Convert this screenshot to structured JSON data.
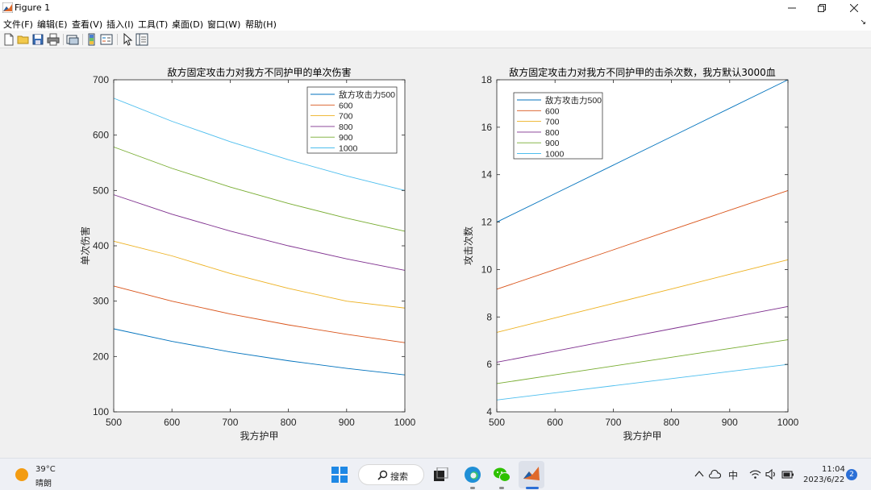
{
  "window": {
    "title": "Figure 1"
  },
  "menu": {
    "items": [
      "文件(F)",
      "编辑(E)",
      "查看(V)",
      "插入(I)",
      "工具(T)",
      "桌面(D)",
      "窗口(W)",
      "帮助(H)"
    ],
    "overflow_arrow": "↘"
  },
  "toolbar": {
    "icons": [
      "new-figure-icon",
      "open-icon",
      "save-icon",
      "print-icon",
      "link-plot-icon",
      "colorbar-icon",
      "legend-icon",
      "pointer-icon",
      "property-inspector-icon"
    ]
  },
  "colors": {
    "series": [
      "#0072BD",
      "#D95319",
      "#EDB120",
      "#7E2F8E",
      "#77AC30",
      "#4DBEEE"
    ]
  },
  "chart_data": [
    {
      "type": "line",
      "title": "敌方固定攻击力对我方不同护甲的单次伤害",
      "xlabel": "我方护甲",
      "ylabel": "单次伤害",
      "xlim": [
        500,
        1000
      ],
      "ylim": [
        100,
        700
      ],
      "xticks": [
        500,
        600,
        700,
        800,
        900,
        1000
      ],
      "yticks": [
        100,
        200,
        300,
        400,
        500,
        600,
        700
      ],
      "legend_position": "top-right",
      "x": [
        500,
        600,
        700,
        800,
        900,
        1000
      ],
      "series": [
        {
          "name": "敌方攻击力500",
          "values": [
            250,
            227.3,
            208.3,
            192.3,
            178.6,
            166.7
          ]
        },
        {
          "name": "600",
          "values": [
            327.3,
            300,
            276.9,
            257.1,
            240,
            225
          ]
        },
        {
          "name": "700",
          "values": [
            408.3,
            381.8,
            350,
            323.1,
            300,
            287.5
          ]
        },
        {
          "name": "800",
          "values": [
            492.3,
            457.1,
            426.7,
            400,
            376.5,
            355.6
          ]
        },
        {
          "name": "900",
          "values": [
            578.6,
            540,
            506.3,
            476.5,
            450,
            426.3
          ]
        },
        {
          "name": "1000",
          "values": [
            666.7,
            625,
            588.2,
            555.6,
            526.3,
            500
          ]
        }
      ]
    },
    {
      "type": "line",
      "title": "敌方固定攻击力对我方不同护甲的击杀次数，我方默认3000血",
      "xlabel": "我方护甲",
      "ylabel": "攻击次数",
      "xlim": [
        500,
        1000
      ],
      "ylim": [
        4,
        18
      ],
      "xticks": [
        500,
        600,
        700,
        800,
        900,
        1000
      ],
      "yticks": [
        4,
        6,
        8,
        10,
        12,
        14,
        16,
        18
      ],
      "legend_position": "top-left",
      "x": [
        500,
        600,
        700,
        800,
        900,
        1000
      ],
      "series": [
        {
          "name": "敌方攻击力500",
          "values": [
            12,
            13.2,
            14.4,
            15.6,
            16.8,
            18
          ]
        },
        {
          "name": "600",
          "values": [
            9.17,
            10,
            10.83,
            11.67,
            12.5,
            13.33
          ]
        },
        {
          "name": "700",
          "values": [
            7.35,
            7.96,
            8.57,
            9.18,
            9.8,
            10.41
          ]
        },
        {
          "name": "800",
          "values": [
            6.09,
            6.56,
            7.03,
            7.5,
            7.97,
            8.44
          ]
        },
        {
          "name": "900",
          "values": [
            5.19,
            5.56,
            5.93,
            6.3,
            6.67,
            7.04
          ]
        },
        {
          "name": "1000",
          "values": [
            4.5,
            4.8,
            5.1,
            5.4,
            5.7,
            6
          ]
        }
      ]
    }
  ],
  "taskbar": {
    "weather_temp": "39°C",
    "weather_cond": "晴朗",
    "search_label": "搜索",
    "ime": "中",
    "time": "11:04",
    "date": "2023/6/22",
    "notifications": "2"
  }
}
